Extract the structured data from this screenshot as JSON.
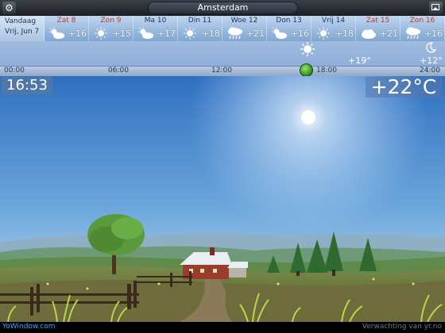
{
  "header": {
    "city": "Amsterdam",
    "settings_icon": "gear-icon",
    "photo_icon": "picture-icon"
  },
  "forecast": {
    "today_label_1": "Vandaag",
    "today_label_2": "Vrij, Jun 7",
    "days": [
      {
        "label": "Zat 8",
        "icon": "partly-cloudy-icon",
        "temp": "+16",
        "weekend": true
      },
      {
        "label": "Zon 9",
        "icon": "sun-icon",
        "temp": "+15",
        "weekend": true
      },
      {
        "label": "Ma 10",
        "icon": "partly-cloudy-icon",
        "temp": "+17",
        "weekend": false
      },
      {
        "label": "Din 11",
        "icon": "sun-icon",
        "temp": "+18",
        "weekend": false
      },
      {
        "label": "Woe 12",
        "icon": "rain-icon",
        "temp": "+21",
        "weekend": false
      },
      {
        "label": "Don 13",
        "icon": "partly-cloudy-icon",
        "temp": "+16",
        "weekend": false
      },
      {
        "label": "Vrij 14",
        "icon": "sun-icon",
        "temp": "+18",
        "weekend": false
      },
      {
        "label": "Zat 15",
        "icon": "cloud-icon",
        "temp": "+21",
        "weekend": true
      },
      {
        "label": "Zon 16",
        "icon": "rain-icon",
        "temp": "+16",
        "weekend": true
      }
    ]
  },
  "timeline": {
    "ticks": [
      "00:00",
      "06:00",
      "12:00",
      "18:00",
      "24:00"
    ],
    "evening_temp": "+19°",
    "night_temp": "+12°",
    "evening_icon": "sun-icon",
    "night_icon": "moon-icon",
    "current_position_fraction": 0.7
  },
  "now": {
    "time": "16:53",
    "temperature": "+22°C"
  },
  "footer": {
    "brand": "YoWindow.com",
    "credit": "Verwachting van yr.no"
  },
  "colors": {
    "sky_top": "#2f6fc0",
    "sky_bottom": "#cfe3f2",
    "brand_link": "#3fa3ff",
    "weekend_red": "#c0392b"
  }
}
